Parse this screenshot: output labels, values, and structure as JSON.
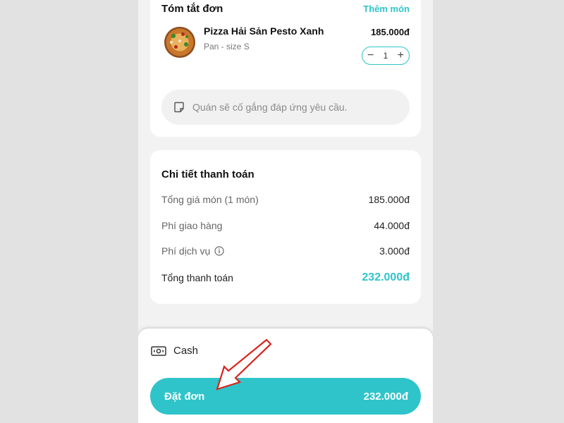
{
  "summary": {
    "title": "Tóm tắt đơn",
    "add_more": "Thêm món",
    "item": {
      "name": "Pizza Hải Sản Pesto Xanh",
      "variant": "Pan - size S",
      "price": "185.000đ",
      "quantity": "1"
    },
    "note_placeholder": "Quán sẽ cố gắng đáp ứng yêu cầu."
  },
  "payment_details": {
    "title": "Chi tiết thanh toán",
    "rows": [
      {
        "label": "Tổng giá món (1 món)",
        "value": "185.000đ"
      },
      {
        "label": "Phí giao hàng",
        "value": "44.000đ"
      },
      {
        "label": "Phí dịch vụ",
        "value": "3.000đ"
      }
    ],
    "total_label": "Tổng thanh toán",
    "total_value": "232.000đ"
  },
  "checkout": {
    "method": "Cash",
    "order_label": "Đặt đơn",
    "order_total": "232.000đ"
  },
  "colors": {
    "accent": "#2fc4c9",
    "annotation_arrow": "#d9241c"
  },
  "icons": [
    "note-icon",
    "info-icon",
    "cash-icon",
    "minus-icon",
    "plus-icon"
  ]
}
